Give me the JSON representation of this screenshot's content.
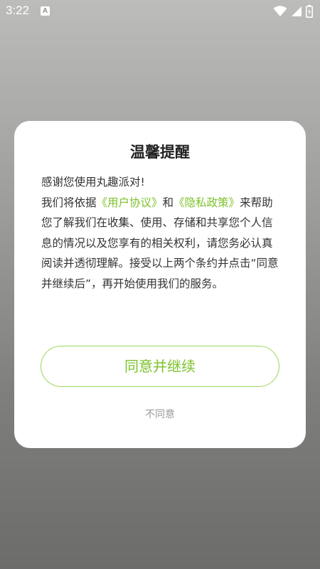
{
  "status_bar": {
    "time": "3:22",
    "notification_icon_letter": "A",
    "icons": [
      "wifi-icon",
      "signal-icon",
      "battery-icon"
    ]
  },
  "dialog": {
    "title": "温馨提醒",
    "line_1": "感谢您使用丸趣派对!",
    "text_before_links": "我们将依据",
    "user_agreement_link": "《用户协议》",
    "and_text": "和",
    "privacy_policy_link": "《隐私政策》",
    "text_after_links": "来帮助您了解我们在收集、使用、存储和共享您个人信息的情况以及您享有的相关权利，请您务必认真阅读并透彻理解。接受以上两个条约并点击“同意并继续后”，再开始使用我们的服务。",
    "agree_button": "同意并继续",
    "disagree_button": "不同意"
  },
  "colors": {
    "accent_green": "#7cc22b",
    "button_border": "#9ad85a",
    "dialog_background": "#ffffff",
    "text": "#333333",
    "muted_text": "#9a9a9a"
  }
}
